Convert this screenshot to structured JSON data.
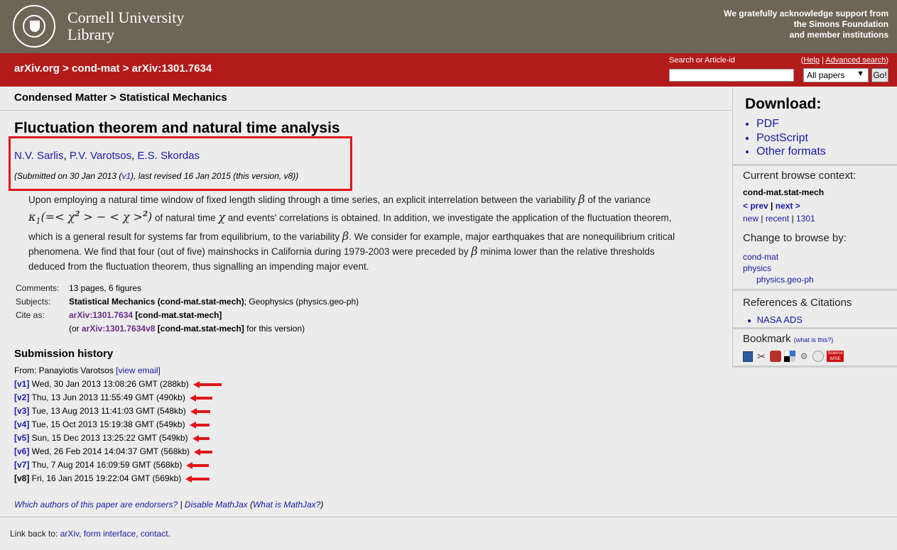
{
  "header": {
    "logo_line1": "Cornell University",
    "logo_line2": "Library",
    "support_line1": "We gratefully acknowledge support from",
    "support_line2": "the Simons Foundation",
    "support_line3": "and member institutions"
  },
  "nav": {
    "crumb_arxiv": "arXiv.org",
    "crumb_sep1": " > ",
    "crumb_cat": "cond-mat",
    "crumb_sep2": " > ",
    "crumb_id": "arXiv:1301.7634",
    "search_label": "Search or Article-id",
    "help_open": "(",
    "help_link": "Help",
    "help_sep": " | ",
    "advanced_link": "Advanced search",
    "help_close": ")",
    "search_value": "",
    "select_value": "All papers",
    "go_label": "Go!"
  },
  "subject": "Condensed Matter > Statistical Mechanics",
  "paper": {
    "title": "Fluctuation theorem and natural time analysis",
    "authors": [
      "N.V. Sarlis",
      "P.V. Varotsos",
      "E.S. Skordas"
    ],
    "submitted_prefix": "(Submitted on 30 Jan 2013 (",
    "submitted_v1": "v1",
    "submitted_suffix": "), last revised 16 Jan 2015 (this version, v8))",
    "abstract": {
      "p1": "Upon employing a natural time window of fixed length sliding through a time series, an explicit interrelation between the variability ",
      "beta": "β",
      "p2": " of the variance",
      "kappa": "κ",
      "kappa_sub": "1",
      "formula_mid": "(=< χ",
      "formula_sup": "2",
      "formula_mid2": " > − < χ >",
      "formula_sup2": "2",
      "formula_end": ")",
      "p3": " of natural time ",
      "chi": "χ",
      "p4": " and events' correlations is obtained. In addition, we investigate the application of the fluctuation theorem, which is a general result for systems far from equilibrium, to the variability ",
      "p5": ". We consider for example, major earthquakes that are nonequilibrium critical phenomena. We find that four (out of five) mainshocks in California during 1979-2003 were preceded by ",
      "p6": " minima lower than the relative thresholds deduced from the fluctuation theorem, thus signalling an impending major event."
    }
  },
  "meta": {
    "comments_label": "Comments:",
    "comments_value": "13 pages, 6 figures",
    "subjects_label": "Subjects:",
    "subjects_primary": "Statistical Mechanics (cond-mat.stat-mech)",
    "subjects_rest": "; Geophysics (physics.geo-ph)",
    "cite_label": "Cite as:",
    "cite_id": "arXiv:1301.7634",
    "cite_cat": " [cond-mat.stat-mech]",
    "cite2_open": "(or ",
    "cite2_id": "arXiv:1301.7634v8",
    "cite2_cat": " [cond-mat.stat-mech]",
    "cite2_close": " for this version)"
  },
  "history": {
    "title": "Submission history",
    "from_prefix": "From: Panayiotis Varotsos ",
    "view_email": "[view email]",
    "versions": [
      {
        "ver": "[v1]",
        "text": " Wed, 30 Jan 2013 13:08:26 GMT (288kb)"
      },
      {
        "ver": "[v2]",
        "text": " Thu, 13 Jun 2013 11:55:49 GMT (490kb)"
      },
      {
        "ver": "[v3]",
        "text": " Tue, 13 Aug 2013 11:41:03 GMT (548kb)"
      },
      {
        "ver": "[v4]",
        "text": " Tue, 15 Oct 2013 15:19:38 GMT (549kb)"
      },
      {
        "ver": "[v5]",
        "text": " Sun, 15 Dec 2013 13:25:22 GMT (549kb)"
      },
      {
        "ver": "[v6]",
        "text": " Wed, 26 Feb 2014 14:04:37 GMT (568kb)"
      },
      {
        "ver": "[v7]",
        "text": " Thu, 7 Aug 2014 16:09:59 GMT (568kb)"
      },
      {
        "ver": "[v8]",
        "text": " Fri, 16 Jan 2015 19:22:04 GMT (569kb)"
      }
    ]
  },
  "endorse": {
    "link1": "Which authors of this paper are endorsers?",
    "sep": " | ",
    "link2": "Disable MathJax",
    "open": " (",
    "link3": "What is MathJax?",
    "close": ")"
  },
  "footer": {
    "prefix": "Link back to: ",
    "arxiv": "arXiv",
    "comma1": ", ",
    "form": "form interface",
    "comma2": ", ",
    "contact": "contact",
    "dot": "."
  },
  "sidebar": {
    "download_title": "Download:",
    "downloads": [
      "PDF",
      "PostScript",
      "Other formats"
    ],
    "context_title": "Current browse context:",
    "context_value": "cond-mat.stat-mech",
    "prev": "< prev",
    "prev_sep": " | ",
    "next": "next >",
    "new": "new",
    "recent": "recent",
    "id_short": "1301",
    "pipe": " | ",
    "change_title": "Change to browse by:",
    "browse_items": [
      "cond-mat",
      "physics",
      "physics.geo-ph"
    ],
    "refs_title": "References & Citations",
    "refs_items": [
      "NASA ADS"
    ],
    "bookmark_title": "Bookmark",
    "bookmark_whatis": "(what is this?)",
    "bookmark_icons": [
      "citeulike-icon",
      "bibsonomy-icon",
      "mendeley-icon",
      "delicious-icon",
      "digg-icon",
      "reddit-icon",
      "sciencewise-icon"
    ],
    "sciencewise_line1": "Science",
    "sciencewise_line2": "WISE"
  },
  "colors": {
    "header_brown": "#6e6557",
    "arxiv_red": "#b31b1b",
    "link_blue": "#1a1aa6",
    "highlight_red": "#e0161b"
  }
}
